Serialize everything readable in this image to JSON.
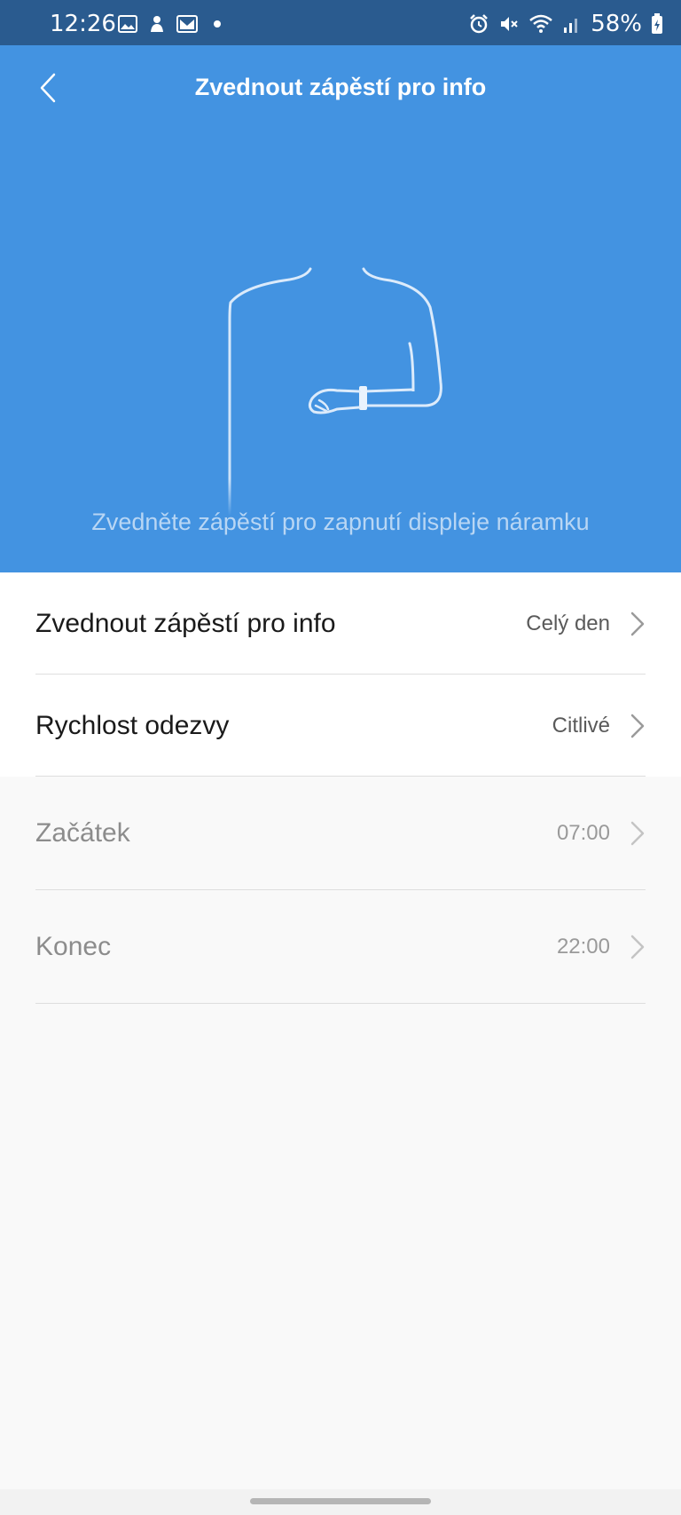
{
  "status_bar": {
    "time": "12:26",
    "battery": "58%",
    "left_icons": [
      "image-icon",
      "android-icon",
      "gmail-icon",
      "dot-icon"
    ],
    "right_icons": [
      "alarm-icon",
      "mute-icon",
      "wifi-icon",
      "signal-icon",
      "battery-icon"
    ]
  },
  "header": {
    "title": "Zvednout zápěstí pro info",
    "back_icon": "chevron-left-icon"
  },
  "hero": {
    "subtitle": "Zvedněte zápěstí pro zapnutí displeje náramku",
    "background": "#4393e1"
  },
  "settings": {
    "rows": [
      {
        "label": "Zvednout zápěstí pro info",
        "value": "Celý den",
        "enabled": true
      },
      {
        "label": "Rychlost odezvy",
        "value": "Citlivé",
        "enabled": true
      },
      {
        "label": "Začátek",
        "value": "07:00",
        "enabled": false
      },
      {
        "label": "Konec",
        "value": "22:00",
        "enabled": false
      }
    ]
  },
  "colors": {
    "status_bar": "#2a5b8f",
    "accent": "#4393e1",
    "page_bg": "#f9f9f9"
  }
}
